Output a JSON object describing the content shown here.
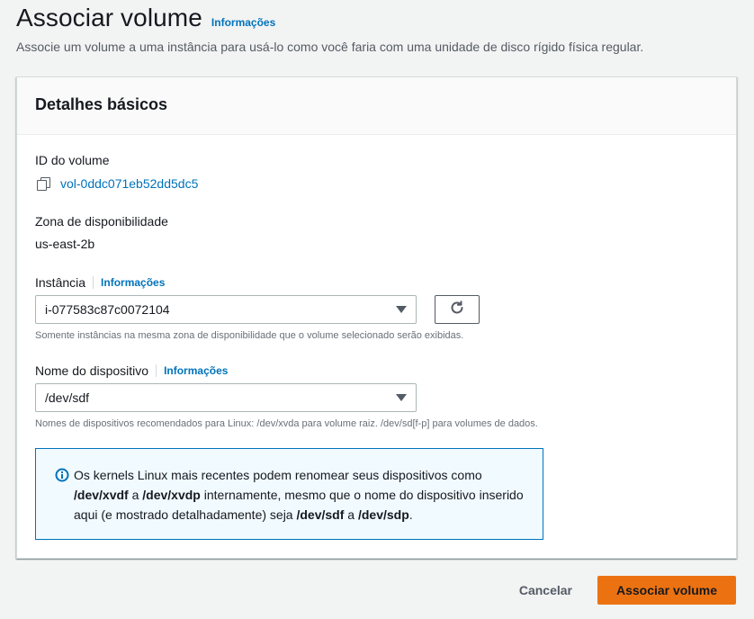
{
  "page": {
    "title": "Associar volume",
    "info_link": "Informações",
    "subtitle": "Associe um volume a uma instância para usá-lo como você faria com uma unidade de disco rígido física regular."
  },
  "panel": {
    "title": "Detalhes básicos",
    "volume_id": {
      "label": "ID do volume",
      "value": "vol-0ddc071eb52dd5dc5",
      "icon": "copy-icon"
    },
    "availability_zone": {
      "label": "Zona de disponibilidade",
      "value": "us-east-2b"
    },
    "instance": {
      "label": "Instância",
      "info_link": "Informações",
      "selected": "i-077583c87c0072104",
      "hint": "Somente instâncias na mesma zona de disponibilidade que o volume selecionado serão exibidas.",
      "refresh_icon": "refresh-icon"
    },
    "device_name": {
      "label": "Nome do dispositivo",
      "info_link": "Informações",
      "selected": "/dev/sdf",
      "hint": "Nomes de dispositivos recomendados para Linux: /dev/xvda para volume raiz. /dev/sd[f-p] para volumes de dados."
    },
    "alert": {
      "icon": "info-icon",
      "text_1": "Os kernels Linux mais recentes podem renomear seus dispositivos como ",
      "bold_1": "/dev/xvdf",
      "text_2": " a ",
      "bold_2": "/dev/xvdp",
      "text_3": " internamente, mesmo que o nome do dispositivo inserido aqui (e mostrado detalhadamente) seja ",
      "bold_3": "/dev/sdf",
      "text_4": " a ",
      "bold_4": "/dev/sdp",
      "text_5": "."
    }
  },
  "footer": {
    "cancel_label": "Cancelar",
    "submit_label": "Associar volume"
  },
  "colors": {
    "accent_link": "#0073bb",
    "primary_button": "#ec7211",
    "alert_background": "#f1faff",
    "alert_border": "#0073bb"
  }
}
